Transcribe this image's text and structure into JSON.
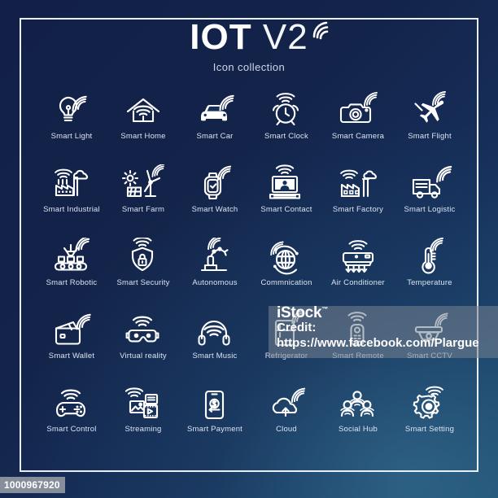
{
  "header": {
    "title_bold": "IOT",
    "title_thin": "V2",
    "subtitle": "Icon collection"
  },
  "colors": {
    "background_dark": "#122047",
    "background_light": "#1d4f76",
    "stroke": "#ffffff",
    "label": "#dbe4f2",
    "frame": "#e8eef7"
  },
  "icons": [
    {
      "label": "Smart Light",
      "icon": "light-bulb-wifi-icon"
    },
    {
      "label": "Smart Home",
      "icon": "house-wifi-icon"
    },
    {
      "label": "Smart Car",
      "icon": "car-wifi-icon"
    },
    {
      "label": "Smart Clock",
      "icon": "alarm-clock-wifi-icon"
    },
    {
      "label": "Smart Camera",
      "icon": "camera-wifi-icon"
    },
    {
      "label": "Smart Flight",
      "icon": "airplane-wifi-icon"
    },
    {
      "label": "Smart Industrial",
      "icon": "factory-smokestack-wifi-icon"
    },
    {
      "label": "Smart Farm",
      "icon": "windmill-solar-wifi-icon"
    },
    {
      "label": "Smart Watch",
      "icon": "smartwatch-wifi-icon"
    },
    {
      "label": "Smart Contact",
      "icon": "computer-video-call-wifi-icon"
    },
    {
      "label": "Smart Factory",
      "icon": "factory-tower-wifi-icon"
    },
    {
      "label": "Smart Logistic",
      "icon": "delivery-truck-wifi-icon"
    },
    {
      "label": "Smart Robotic",
      "icon": "robotic-arm-conveyor-wifi-icon"
    },
    {
      "label": "Smart Security",
      "icon": "shield-lock-wifi-icon"
    },
    {
      "label": "Autonomous",
      "icon": "robot-arm-wifi-icon"
    },
    {
      "label": "Commnication",
      "icon": "globe-network-wifi-icon"
    },
    {
      "label": "Air Conditioner",
      "icon": "air-conditioner-wifi-icon"
    },
    {
      "label": "Temperature",
      "icon": "thermometer-wifi-icon"
    },
    {
      "label": "Smart Wallet",
      "icon": "wallet-wifi-icon"
    },
    {
      "label": "Virtual reality",
      "icon": "vr-headset-wifi-icon"
    },
    {
      "label": "Smart Music",
      "icon": "headphones-wifi-icon"
    },
    {
      "label": "Refrigerator",
      "icon": "refrigerator-wifi-icon"
    },
    {
      "label": "Smart Remote",
      "icon": "remote-control-wifi-icon"
    },
    {
      "label": "Smart CCTV",
      "icon": "cctv-camera-wifi-icon"
    },
    {
      "label": "Smart Control",
      "icon": "gamepad-wifi-icon"
    },
    {
      "label": "Streaming",
      "icon": "media-streaming-wifi-icon"
    },
    {
      "label": "Smart Payment",
      "icon": "phone-dollar-wifi-icon"
    },
    {
      "label": "Cloud",
      "icon": "cloud-upload-wifi-icon"
    },
    {
      "label": "Social Hub",
      "icon": "people-group-wifi-icon"
    },
    {
      "label": "Smart Setting",
      "icon": "gear-wifi-icon"
    }
  ],
  "watermark": {
    "brand": "iStock",
    "tm": "™",
    "credit_label": "Credit:",
    "url": "https://www.facebook.com/Plargue"
  },
  "asset_id": "1000967920"
}
